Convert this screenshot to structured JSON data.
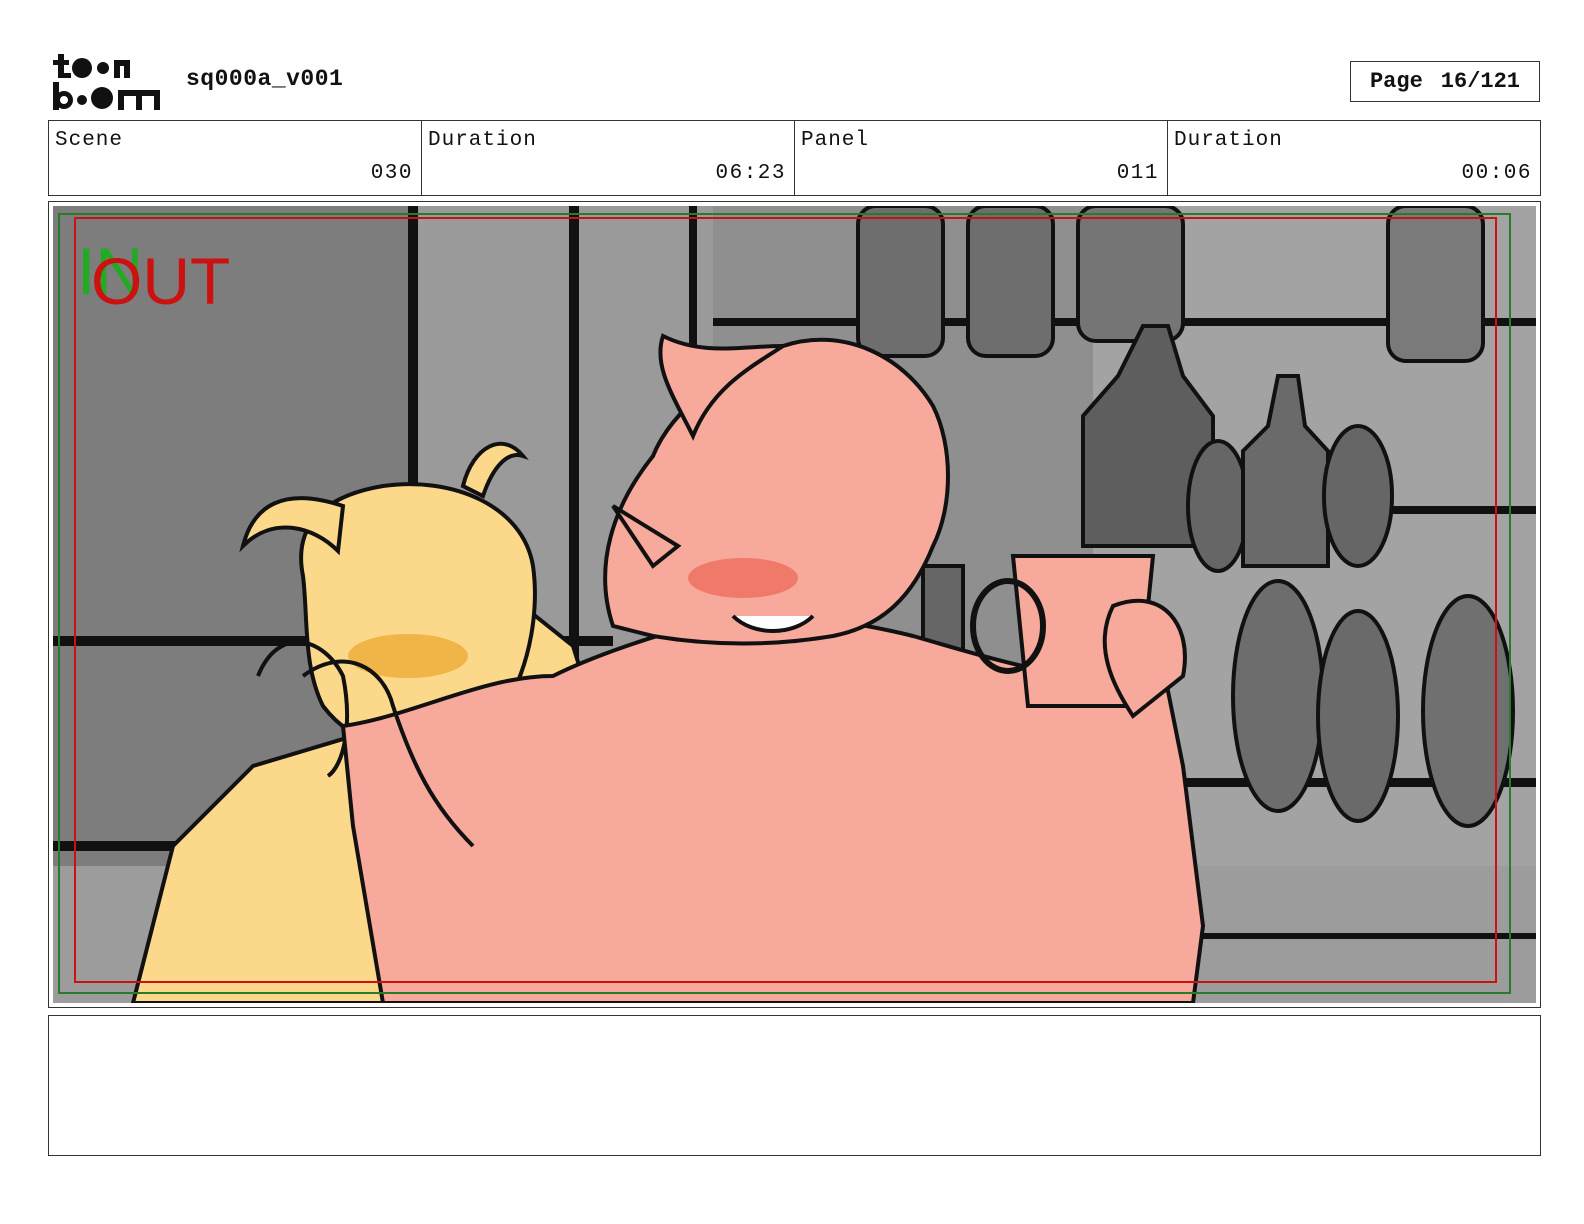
{
  "header": {
    "logo_text": "toon boom",
    "project_name": "sq000a_v001",
    "page_label": "Page",
    "page_value": "16/121"
  },
  "info": [
    {
      "label": "Scene",
      "value": "030"
    },
    {
      "label": "Duration",
      "value": "06:23"
    },
    {
      "label": "Panel",
      "value": "011"
    },
    {
      "label": "Duration",
      "value": "00:06"
    }
  ],
  "panel": {
    "in_marker": "IN",
    "out_marker": "OUT",
    "colors": {
      "in_marker": "#22aa22",
      "out_marker": "#cc1111",
      "left_character": "#fcd98a",
      "right_character": "#f7a99c",
      "background": "#8a8a8a"
    }
  },
  "notes": {
    "text": ""
  }
}
